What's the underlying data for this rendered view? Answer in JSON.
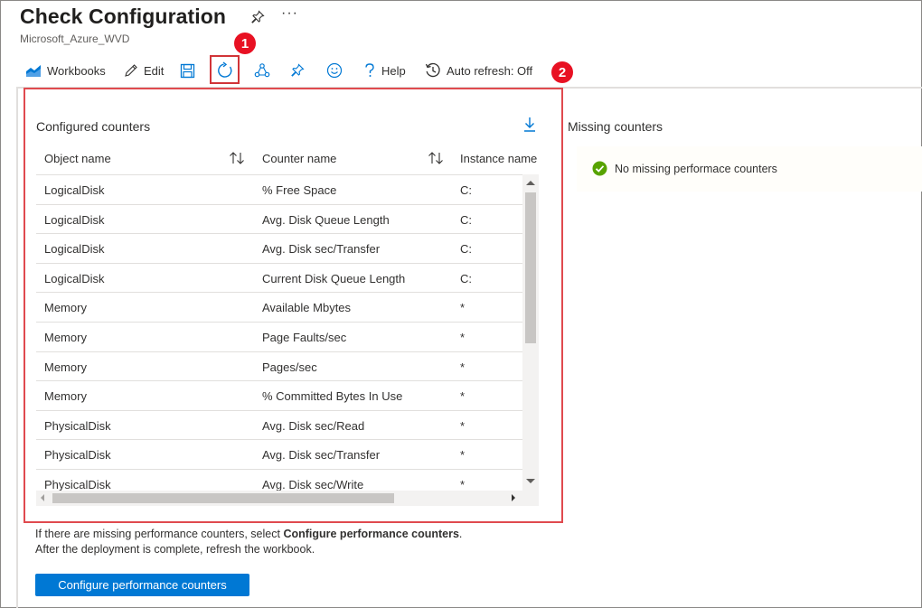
{
  "page": {
    "title": "Check Configuration",
    "subtitle": "Microsoft_Azure_WVD",
    "more_label": "···"
  },
  "toolbar": {
    "workbooks_label": "Workbooks",
    "edit_label": "Edit",
    "help_label": "Help",
    "auto_refresh_label": "Auto refresh: Off",
    "icons": [
      "workbooks-icon",
      "edit-icon",
      "save-icon",
      "refresh-icon",
      "share-icon",
      "pin-icon",
      "feedback-icon",
      "help-icon",
      "auto-refresh-icon"
    ]
  },
  "annotations": {
    "badge_1": "1",
    "badge_2": "2"
  },
  "configured": {
    "title": "Configured counters",
    "columns": [
      "Object name",
      "Counter name",
      "Instance name"
    ],
    "rows": [
      [
        "LogicalDisk",
        "% Free Space",
        "C:"
      ],
      [
        "LogicalDisk",
        "Avg. Disk Queue Length",
        "C:"
      ],
      [
        "LogicalDisk",
        "Avg. Disk sec/Transfer",
        "C:"
      ],
      [
        "LogicalDisk",
        "Current Disk Queue Length",
        "C:"
      ],
      [
        "Memory",
        "Available Mbytes",
        "*"
      ],
      [
        "Memory",
        "Page Faults/sec",
        "*"
      ],
      [
        "Memory",
        "Pages/sec",
        "*"
      ],
      [
        "Memory",
        "% Committed Bytes In Use",
        "*"
      ],
      [
        "PhysicalDisk",
        "Avg. Disk sec/Read",
        "*"
      ],
      [
        "PhysicalDisk",
        "Avg. Disk sec/Transfer",
        "*"
      ],
      [
        "PhysicalDisk",
        "Avg. Disk sec/Write",
        "*"
      ]
    ]
  },
  "missing": {
    "title": "Missing counters",
    "message": "No missing performace counters"
  },
  "note": {
    "line1_prefix": "If there are missing performance counters, select ",
    "line1_bold": "Configure performance counters",
    "line1_suffix": ".",
    "line2": "After the deployment is complete, refresh the workbook."
  },
  "button": {
    "configure_label": "Configure performance counters"
  },
  "colors": {
    "accent": "#0078d4",
    "highlight_red": "#e04a4f",
    "badge_red": "#e81123",
    "success_green": "#57a300"
  }
}
